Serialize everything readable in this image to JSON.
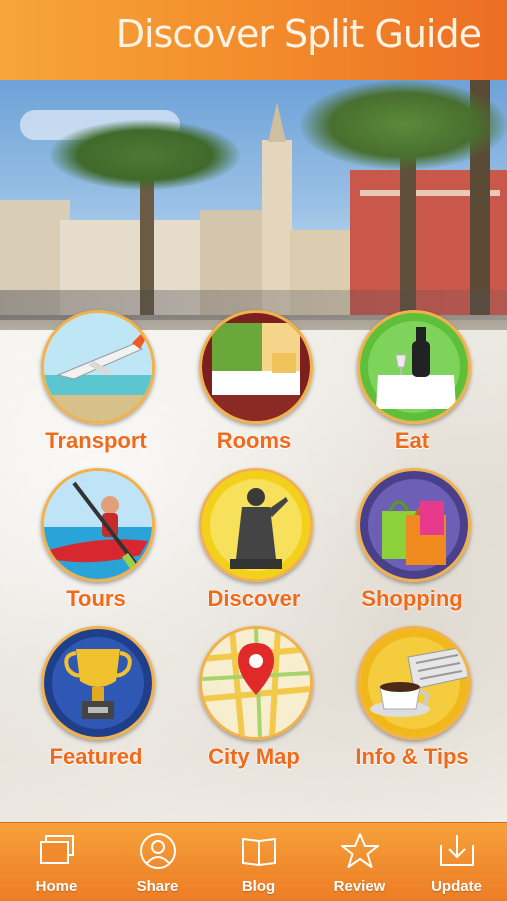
{
  "header": {
    "title": "Discover Split Guide"
  },
  "grid": [
    {
      "label": "Transport",
      "icon": "airplane-icon"
    },
    {
      "label": "Rooms",
      "icon": "hotel-room-icon"
    },
    {
      "label": "Eat",
      "icon": "wine-table-icon"
    },
    {
      "label": "Tours",
      "icon": "kayak-icon"
    },
    {
      "label": "Discover",
      "icon": "statue-icon"
    },
    {
      "label": "Shopping",
      "icon": "shopping-bags-icon"
    },
    {
      "label": "Featured",
      "icon": "trophy-icon"
    },
    {
      "label": "City Map",
      "icon": "map-pin-icon"
    },
    {
      "label": "Info & Tips",
      "icon": "coffee-newspaper-icon"
    }
  ],
  "tabbar": [
    {
      "label": "Home",
      "icon": "home-icon"
    },
    {
      "label": "Share",
      "icon": "share-icon"
    },
    {
      "label": "Blog",
      "icon": "book-icon"
    },
    {
      "label": "Review",
      "icon": "star-icon"
    },
    {
      "label": "Update",
      "icon": "download-icon"
    }
  ],
  "colors": {
    "accent": "#f28a2b",
    "label": "#ef6a1b",
    "disc_border": "#f2b14a"
  }
}
